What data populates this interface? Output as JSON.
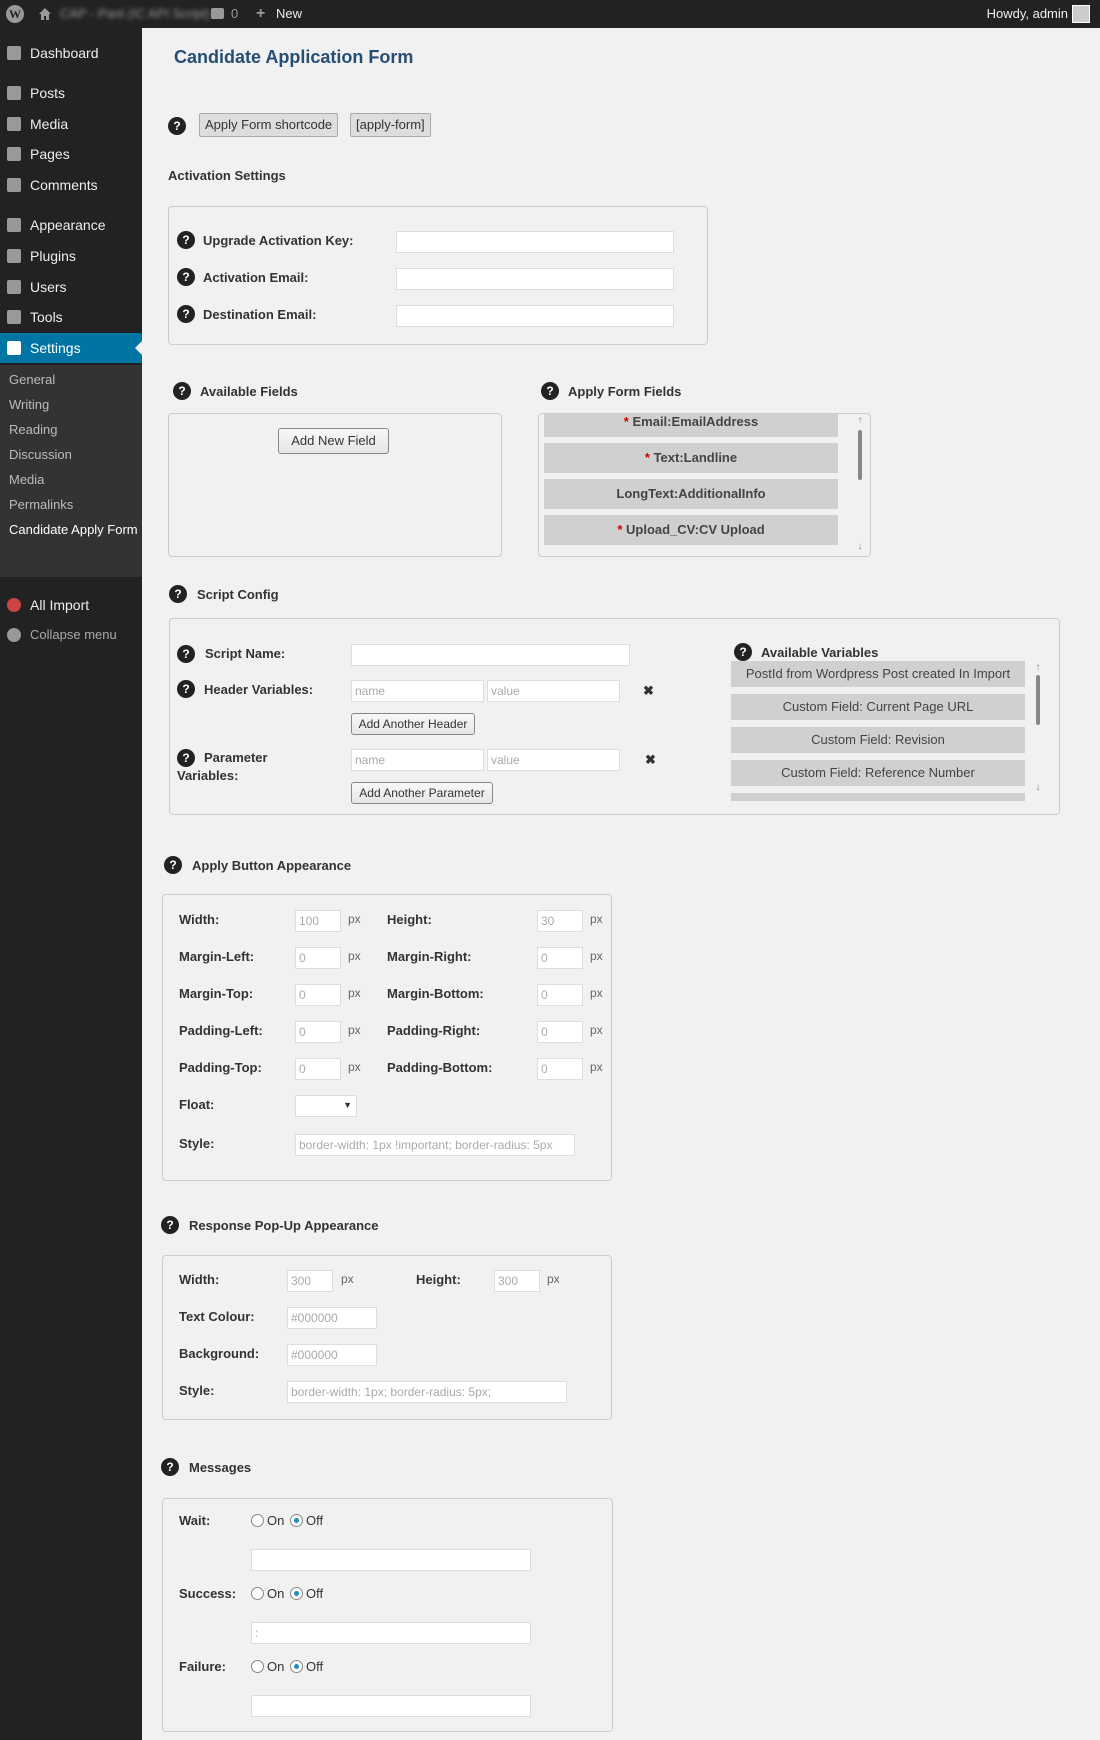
{
  "adminbar": {
    "site_name": "CAP - Panl (IC API Script)",
    "comments_count": "0",
    "new_label": "New",
    "howdy": "Howdy, admin"
  },
  "sidebar": {
    "items": [
      {
        "label": "Dashboard",
        "icon": "dashboard-icon"
      },
      {
        "label": "Posts",
        "icon": "pin-icon"
      },
      {
        "label": "Media",
        "icon": "media-icon"
      },
      {
        "label": "Pages",
        "icon": "page-icon"
      },
      {
        "label": "Comments",
        "icon": "comment-icon"
      },
      {
        "label": "Appearance",
        "icon": "brush-icon"
      },
      {
        "label": "Plugins",
        "icon": "plugin-icon"
      },
      {
        "label": "Users",
        "icon": "user-icon"
      },
      {
        "label": "Tools",
        "icon": "wrench-icon"
      },
      {
        "label": "Settings",
        "icon": "settings-icon"
      }
    ],
    "submenu": [
      "General",
      "Writing",
      "Reading",
      "Discussion",
      "Media",
      "Permalinks",
      "Candidate Apply Form"
    ],
    "all_import": "All Import",
    "collapse": "Collapse menu"
  },
  "page": {
    "title": "Candidate Application Form",
    "shortcode_label": "Apply Form shortcode",
    "shortcode_value": "[apply-form]",
    "activation_title": "Activation Settings",
    "activation": {
      "upgrade_key_label": "Upgrade Activation Key:",
      "upgrade_key_value": "",
      "activation_email_label": "Activation Email:",
      "activation_email_value": "",
      "destination_email_label": "Destination Email:",
      "destination_email_value": ""
    },
    "available_fields_title": "Available Fields",
    "add_new_field": "Add New Field",
    "apply_form_fields_title": "Apply Form Fields",
    "apply_form_fields": [
      {
        "required": "*",
        "label": "Email:EmailAddress"
      },
      {
        "required": "*",
        "label": "Text:Landline"
      },
      {
        "required": "",
        "label": "LongText:AdditionalInfo"
      },
      {
        "required": "*",
        "label": "Upload_CV:CV Upload"
      }
    ],
    "script_config_title": "Script Config",
    "script": {
      "script_name_label": "Script Name:",
      "script_name_value": "",
      "header_vars_label": "Header Variables:",
      "name_placeholder": "name",
      "value_placeholder": "value",
      "add_header": "Add Another Header",
      "param_vars_label_1": "Parameter",
      "param_vars_label_2": "Variables:",
      "add_param": "Add Another Parameter",
      "available_vars_title": "Available Variables",
      "available_vars": [
        "PostId from Wordpress Post created In Import",
        "Custom Field: Current Page URL",
        "Custom Field: Revision",
        "Custom Field: Reference Number"
      ]
    },
    "apply_button_title": "Apply Button Appearance",
    "apply_button": {
      "width_label": "Width:",
      "width": "100",
      "height_label": "Height:",
      "height": "30",
      "ml_label": "Margin-Left:",
      "ml": "0",
      "mr_label": "Margin-Right:",
      "mr": "0",
      "mt_label": "Margin-Top:",
      "mt": "0",
      "mb_label": "Margin-Bottom:",
      "mb": "0",
      "pl_label": "Padding-Left:",
      "pl": "0",
      "pr_label": "Padding-Right:",
      "pr": "0",
      "pt_label": "Padding-Top:",
      "pt": "0",
      "pb_label": "Padding-Bottom:",
      "pb": "0",
      "float_label": "Float:",
      "style_label": "Style:",
      "style_value": "border-width: 1px !important; border-radius: 5px",
      "px": "px"
    },
    "popup_title": "Response Pop-Up Appearance",
    "popup": {
      "width_label": "Width:",
      "width": "300",
      "height_label": "Height:",
      "height": "300",
      "text_colour_label": "Text Colour:",
      "text_colour": "#000000",
      "background_label": "Background:",
      "background": "#000000",
      "style_label": "Style:",
      "style_value": "border-width: 1px; border-radius: 5px;",
      "px": "px"
    },
    "messages_title": "Messages",
    "messages": {
      "wait_label": "Wait:",
      "success_label": "Success:",
      "failure_label": "Failure:",
      "on": "On",
      "off": "Off",
      "wait_value": "",
      "success_value": ":",
      "failure_value": ""
    },
    "help_glyph": "?",
    "close_glyph": "✖"
  }
}
